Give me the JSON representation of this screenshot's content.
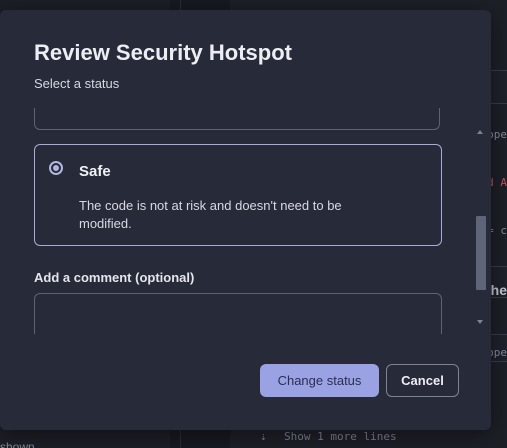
{
  "modal": {
    "title": "Review Security Hotspot",
    "subtitle": "Select a status"
  },
  "status_option": {
    "label": "Safe",
    "description": "The code is not at risk and doesn't need to be modified.",
    "selected": true
  },
  "comment": {
    "label": "Add a comment (optional)",
    "value": "",
    "placeholder": ""
  },
  "actions": {
    "primary_label": "Change status",
    "secondary_label": "Cancel"
  },
  "background": {
    "code_fragments": [
      "ope",
      "d A",
      "= c",
      "he",
      "ope"
    ],
    "show_more": "Show 1 more lines",
    "left_fragment": "shown"
  },
  "colors": {
    "modal_bg": "#272a38",
    "accent": "#9ba2e3",
    "selected_border": "#a9acd6"
  }
}
